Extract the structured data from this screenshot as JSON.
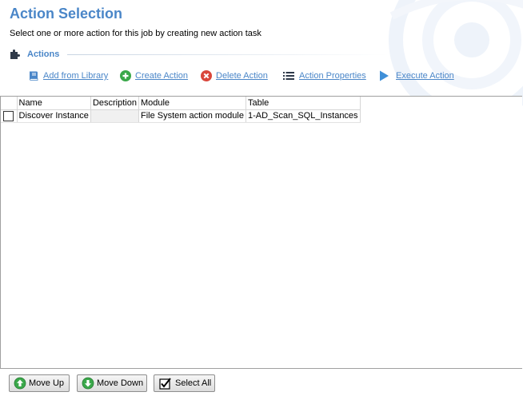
{
  "header": {
    "title": "Action Selection",
    "subtitle": "Select one or more action for this job by creating new action task"
  },
  "actions_section": {
    "label": "Actions",
    "icon": "puzzle-icon"
  },
  "toolbar": {
    "items": [
      {
        "label": "Add from Library",
        "icon": "book-icon"
      },
      {
        "label": "Create Action",
        "icon": "plus-circle-icon"
      },
      {
        "label": "Delete Action",
        "icon": "delete-circle-icon"
      },
      {
        "label": "Action Properties",
        "icon": "list-icon"
      },
      {
        "label": "Execute Action",
        "icon": "play-icon"
      }
    ]
  },
  "table": {
    "columns": [
      "Name",
      "Description",
      "Module",
      "Table"
    ],
    "rows": [
      {
        "checked": false,
        "name": "Discover Instance",
        "description": "",
        "module": "File System action module",
        "table": "1-AD_Scan_SQL_Instances"
      }
    ]
  },
  "footer": {
    "move_up": "Move Up",
    "move_down": "Move Down",
    "select_all": "Select All"
  },
  "colors": {
    "accent": "#4a86c8",
    "green": "#3aa84a",
    "red": "#d9463b"
  }
}
